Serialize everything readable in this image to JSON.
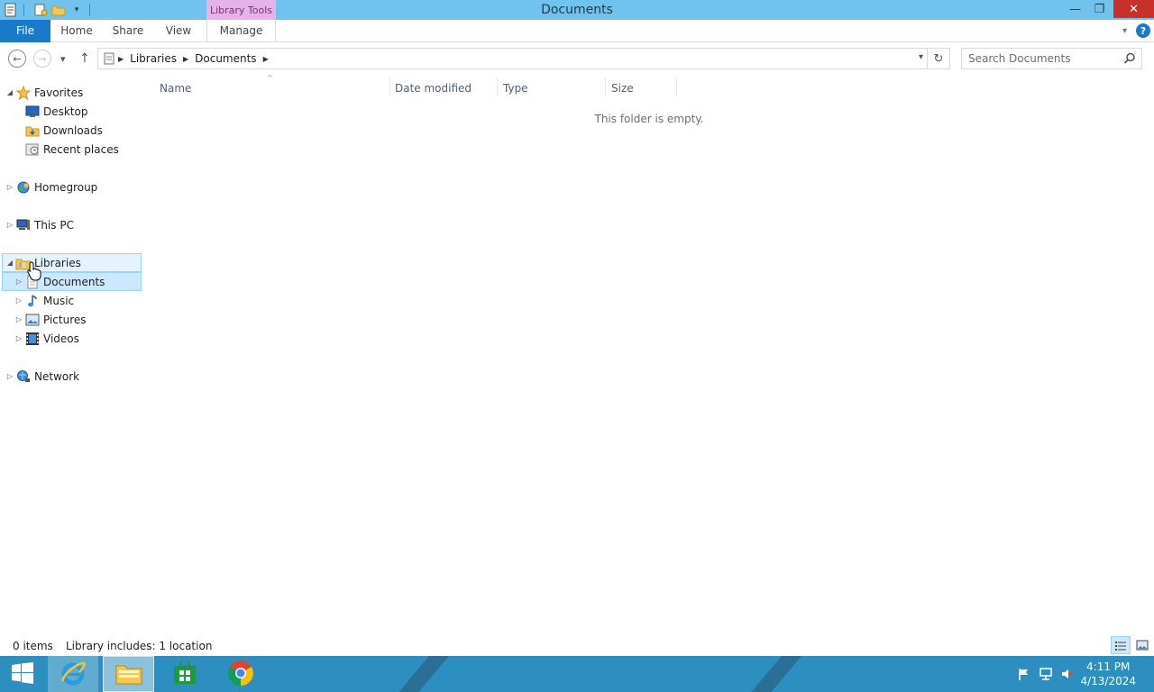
{
  "window": {
    "title": "Documents",
    "context_tab": "Library Tools",
    "minimize": "—",
    "restore": "❐",
    "close": "✕"
  },
  "ribbon": {
    "tabs": [
      {
        "label": "File"
      },
      {
        "label": "Home"
      },
      {
        "label": "Share"
      },
      {
        "label": "View"
      },
      {
        "label": "Manage"
      }
    ],
    "help": "?"
  },
  "address": {
    "back": "←",
    "forward": "→",
    "recent": "▾",
    "up": "↑",
    "breadcrumbs": [
      "Libraries",
      "Documents"
    ],
    "refresh": "↻",
    "search_placeholder": "Search Documents"
  },
  "nav": {
    "favorites": {
      "label": "Favorites",
      "items": [
        "Desktop",
        "Downloads",
        "Recent places"
      ]
    },
    "homegroup": "Homegroup",
    "this_pc": "This PC",
    "libraries": {
      "label": "Libraries",
      "items": [
        "Documents",
        "Music",
        "Pictures",
        "Videos"
      ]
    },
    "network": "Network"
  },
  "content": {
    "columns": [
      "Name",
      "Date modified",
      "Type",
      "Size"
    ],
    "empty_message": "This folder is empty."
  },
  "status": {
    "items": "0 items",
    "library_info": "Library includes: 1 location"
  },
  "taskbar": {
    "time": "4:11 PM",
    "date": "4/13/2024"
  },
  "colors": {
    "titlebar": "#6fc3ec",
    "file_tab": "#1979ca",
    "context_tab": "#e6b3e8",
    "close": "#c7312a",
    "taskbar": "#2d8fbf",
    "selection": "#cce8ff"
  }
}
